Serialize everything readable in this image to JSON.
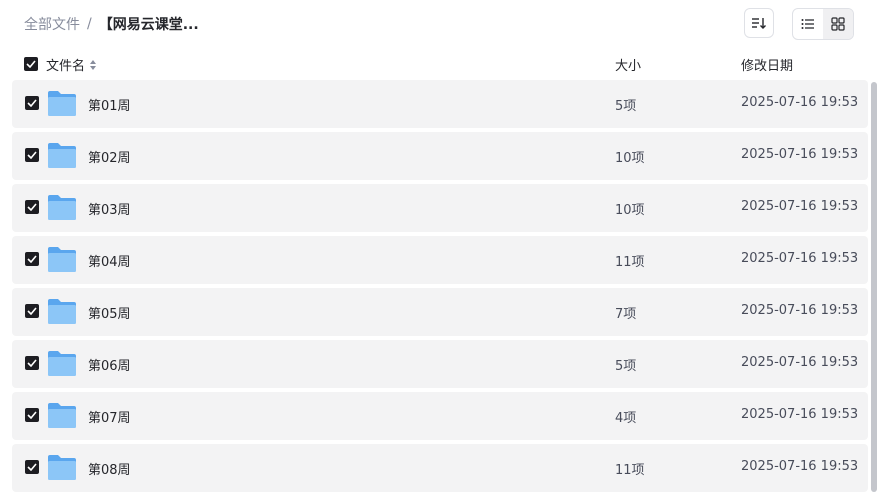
{
  "breadcrumb": {
    "root": "全部文件",
    "separator": "/",
    "current": "【网易云课堂..."
  },
  "toolbar": {
    "sort_icon": "sort-descending-icon",
    "list_icon": "list-view-icon",
    "grid_icon": "grid-view-icon",
    "active_view": "list"
  },
  "header": {
    "name": "文件名",
    "size": "大小",
    "modified": "修改日期",
    "all_checked": true
  },
  "rows": [
    {
      "name": "第01周",
      "size": "5项",
      "modified": "2025-07-16 19:53",
      "checked": true
    },
    {
      "name": "第02周",
      "size": "10项",
      "modified": "2025-07-16 19:53",
      "checked": true
    },
    {
      "name": "第03周",
      "size": "10项",
      "modified": "2025-07-16 19:53",
      "checked": true
    },
    {
      "name": "第04周",
      "size": "11项",
      "modified": "2025-07-16 19:53",
      "checked": true
    },
    {
      "name": "第05周",
      "size": "7项",
      "modified": "2025-07-16 19:53",
      "checked": true
    },
    {
      "name": "第06周",
      "size": "5项",
      "modified": "2025-07-16 19:53",
      "checked": true
    },
    {
      "name": "第07周",
      "size": "4项",
      "modified": "2025-07-16 19:53",
      "checked": true
    },
    {
      "name": "第08周",
      "size": "11项",
      "modified": "2025-07-16 19:53",
      "checked": true
    }
  ],
  "colors": {
    "row_bg": "#f3f3f4",
    "folder": "#6ab0f0",
    "checkbox": "#1d1d22",
    "muted_text": "#878c9c"
  }
}
